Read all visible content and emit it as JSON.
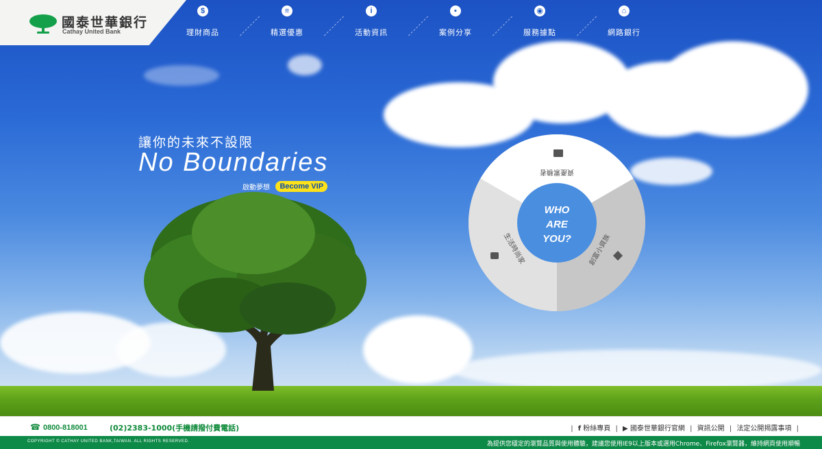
{
  "brand": {
    "name_cn": "國泰世華銀行",
    "name_en": "Cathay United Bank",
    "color_green": "#0e8a48"
  },
  "nav": {
    "items": [
      {
        "label": "理財商品",
        "icon": "dollar-icon",
        "glyph": "$"
      },
      {
        "label": "精選優惠",
        "icon": "list-icon",
        "glyph": "≡"
      },
      {
        "label": "活動資訊",
        "icon": "info-icon",
        "glyph": "i"
      },
      {
        "label": "案例分享",
        "icon": "chat-icon",
        "glyph": "▪"
      },
      {
        "label": "服務據點",
        "icon": "location-pin-icon",
        "glyph": "◉"
      },
      {
        "label": "網路銀行",
        "icon": "bank-icon",
        "glyph": "⌂"
      }
    ]
  },
  "hero": {
    "tagline_cn": "讓你的未來不設限",
    "tagline_en": "No Boundaries",
    "sub_text": "啟動夢想",
    "vip_button": "Become VIP"
  },
  "wheel": {
    "center_text": [
      "WHO",
      "ARE",
      "YOU?"
    ],
    "segments": [
      {
        "label": "資產累積者",
        "icon": "briefcase-icon",
        "selected": true
      },
      {
        "label": "創富小資族",
        "icon": "tag-icon",
        "selected": false
      },
      {
        "label": "生活時尚家",
        "icon": "shopping-bag-icon",
        "selected": false
      }
    ],
    "colors": {
      "selected": "#ffffff",
      "segment_light": "#dcdcdc",
      "segment_dark": "#c9c9c9",
      "center": "#4a8ee0",
      "pointer": "#f2d51b"
    }
  },
  "footer": {
    "phone_1": "0800-818001",
    "phone_2": "(02)2383-1000(手機請撥付費電話)",
    "links": [
      "粉絲專頁",
      "國泰世華銀行官網",
      "資訊公開",
      "法定公開揭露事項"
    ],
    "copyright": "COPYRIGHT © CATHAY UNITED BANK,TAIWAN. ALL RIGHTS RESERVED.",
    "browser_notice": "為提供您穩定的瀏覽品質與使用體驗，建議您使用IE9以上版本或選用Chrome、Firefox瀏覽器，維持網頁使用順暢"
  }
}
